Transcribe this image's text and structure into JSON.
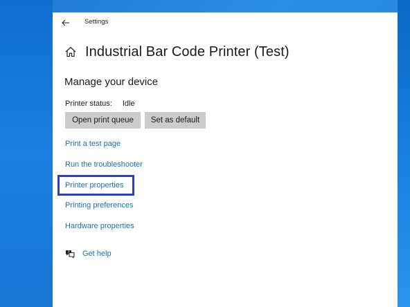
{
  "window": {
    "app_title": "Settings"
  },
  "header": {
    "title": "Industrial Bar Code Printer (Test)"
  },
  "section": {
    "title": "Manage your device"
  },
  "status": {
    "label": "Printer status:",
    "value": "Idle"
  },
  "buttons": {
    "open_queue": "Open print queue",
    "set_default": "Set as default"
  },
  "links": [
    "Print a test page",
    "Run the troubleshooter",
    "Printer properties",
    "Printing preferences",
    "Hardware properties"
  ],
  "help": {
    "label": "Get help"
  },
  "colors": {
    "accent_link": "#1a6fb0",
    "highlight_border": "#2a3cc9",
    "button_bg": "#cccccc",
    "desktop": "#1e78d4"
  },
  "highlighted_link": "Printer properties"
}
